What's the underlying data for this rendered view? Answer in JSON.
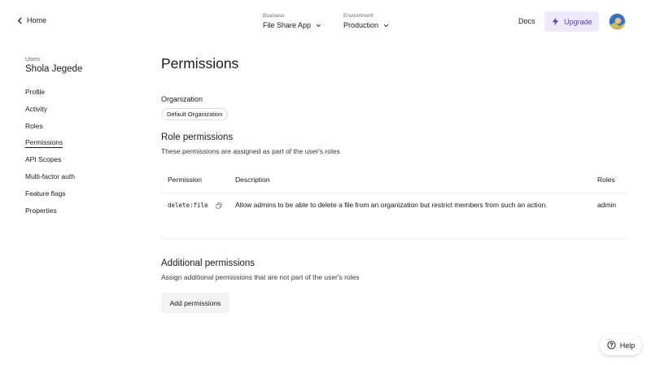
{
  "header": {
    "home_label": "Home",
    "business": {
      "caption": "Business",
      "value": "File Share App"
    },
    "environment": {
      "caption": "Environment",
      "value": "Production"
    },
    "docs_label": "Docs",
    "upgrade_label": "Upgrade",
    "accent_color": "#5b3ab8"
  },
  "sidebar": {
    "caption": "Users",
    "user_name": "Shola Jegede",
    "items": [
      {
        "label": "Profile"
      },
      {
        "label": "Activity"
      },
      {
        "label": "Roles"
      },
      {
        "label": "Permissions",
        "active": true
      },
      {
        "label": "API Scopes"
      },
      {
        "label": "Multi-factor auth"
      },
      {
        "label": "Feature flags"
      },
      {
        "label": "Properties"
      }
    ]
  },
  "main": {
    "title": "Permissions",
    "organization": {
      "label": "Organization",
      "chip": "Default Organization"
    },
    "role_permissions": {
      "title": "Role permissions",
      "subtitle": "These permissions are assigned as part of the user's roles",
      "columns": [
        "Permission",
        "Description",
        "Roles"
      ],
      "rows": [
        {
          "permission": "delete:file",
          "description": "Allow admins to be able to delete a file from an organization but restrict members from such an action.",
          "roles": "admin"
        }
      ]
    },
    "additional_permissions": {
      "title": "Additional permissions",
      "subtitle": "Assign additional permissions that are not part of the user's roles",
      "button_label": "Add permissions"
    }
  },
  "help": {
    "label": "Help"
  }
}
